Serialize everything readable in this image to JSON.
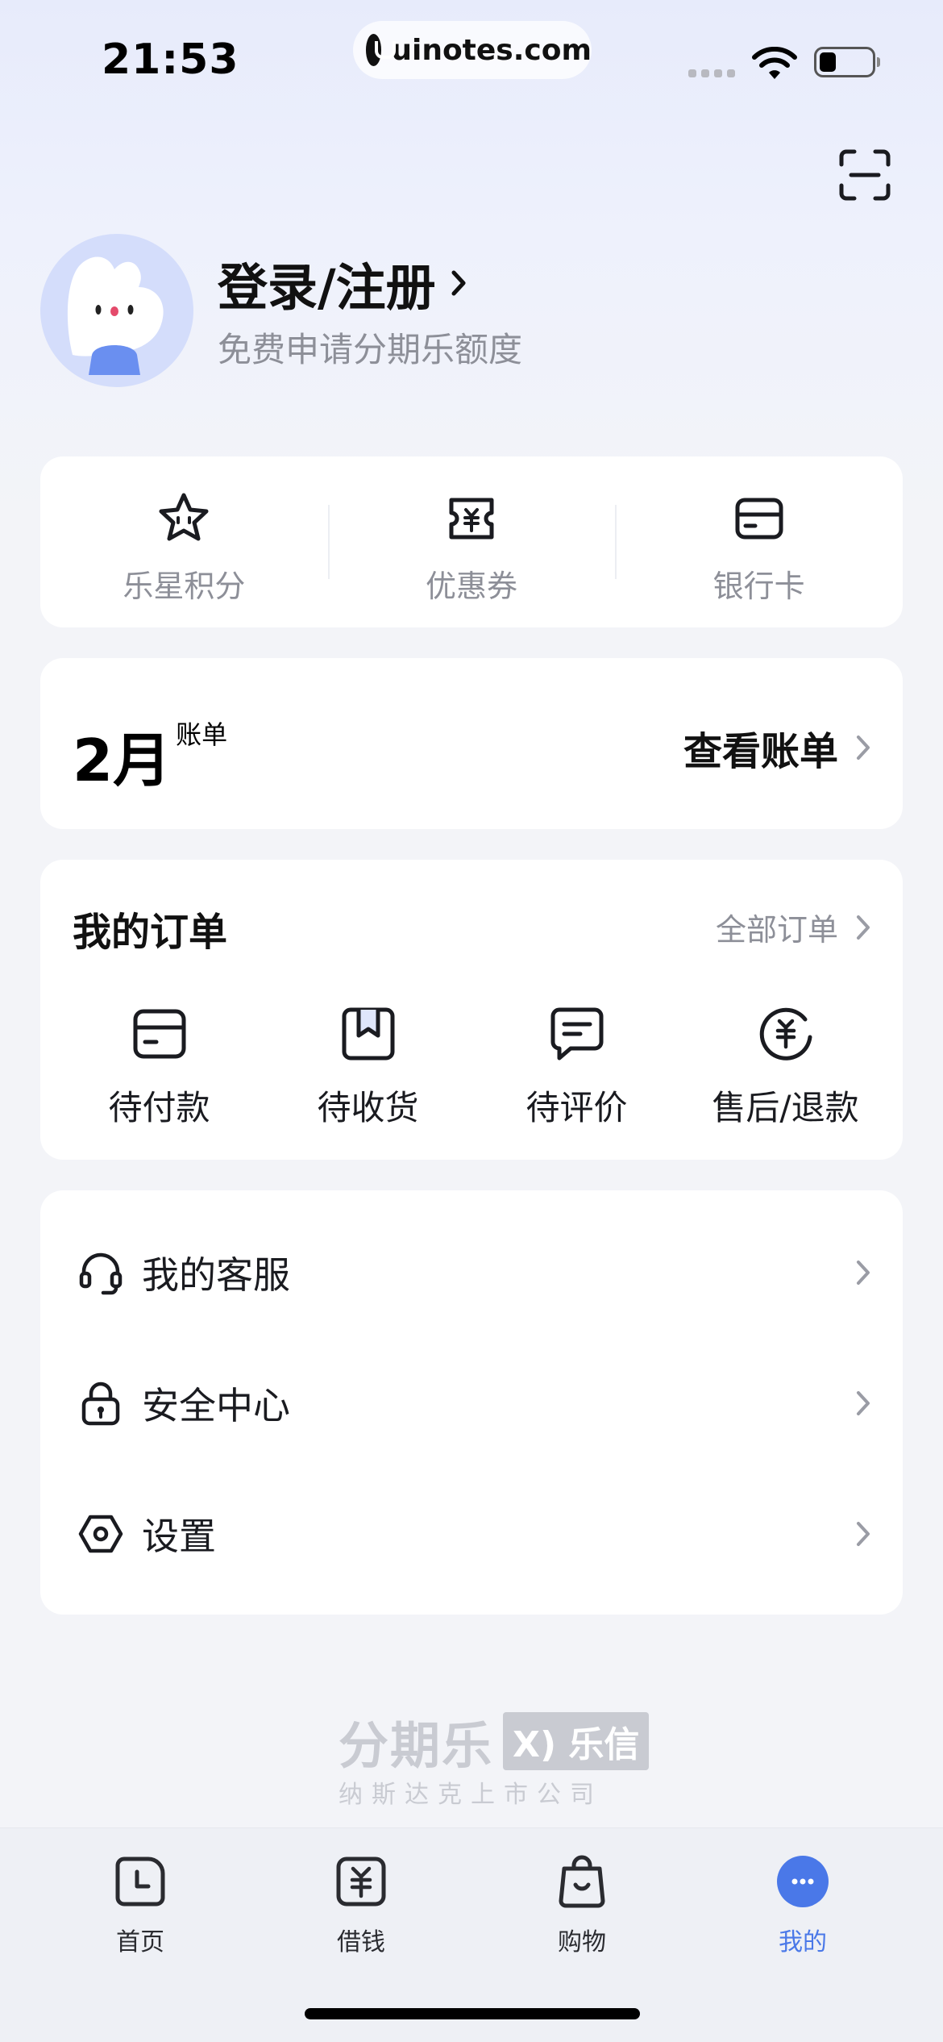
{
  "status_bar": {
    "time": "21:53",
    "url": "uinotes.com"
  },
  "profile": {
    "title": "登录/注册",
    "subtitle": "免费申请分期乐额度"
  },
  "quick_links": [
    {
      "label": "乐星积分",
      "icon": "star-face-icon"
    },
    {
      "label": "优惠券",
      "icon": "coupon-icon"
    },
    {
      "label": "银行卡",
      "icon": "bank-card-icon"
    }
  ],
  "bill": {
    "month": "2月",
    "month_suffix": "账单",
    "link": "查看账单"
  },
  "orders": {
    "title": "我的订单",
    "all_link": "全部订单",
    "items": [
      {
        "label": "待付款",
        "icon": "wallet-icon"
      },
      {
        "label": "待收货",
        "icon": "package-icon"
      },
      {
        "label": "待评价",
        "icon": "comment-icon"
      },
      {
        "label": "售后/退款",
        "icon": "refund-icon"
      }
    ]
  },
  "menu": [
    {
      "label": "我的客服",
      "icon": "headset-icon"
    },
    {
      "label": "安全中心",
      "icon": "lock-icon"
    },
    {
      "label": "设置",
      "icon": "hexagon-settings-icon"
    }
  ],
  "footer": {
    "brand": "分期乐",
    "brand_partner": "乐信",
    "tagline": "纳斯达克上市公司"
  },
  "tabbar": [
    {
      "label": "首页",
      "icon": "clock-home-icon",
      "active": false
    },
    {
      "label": "借钱",
      "icon": "yuan-icon",
      "active": false
    },
    {
      "label": "购物",
      "icon": "shopping-bag-icon",
      "active": false
    },
    {
      "label": "我的",
      "icon": "me-icon",
      "active": true
    }
  ],
  "colors": {
    "accent": "#4a78e8",
    "muted": "#8d8f98",
    "page_bg": "#f3f4f8"
  }
}
